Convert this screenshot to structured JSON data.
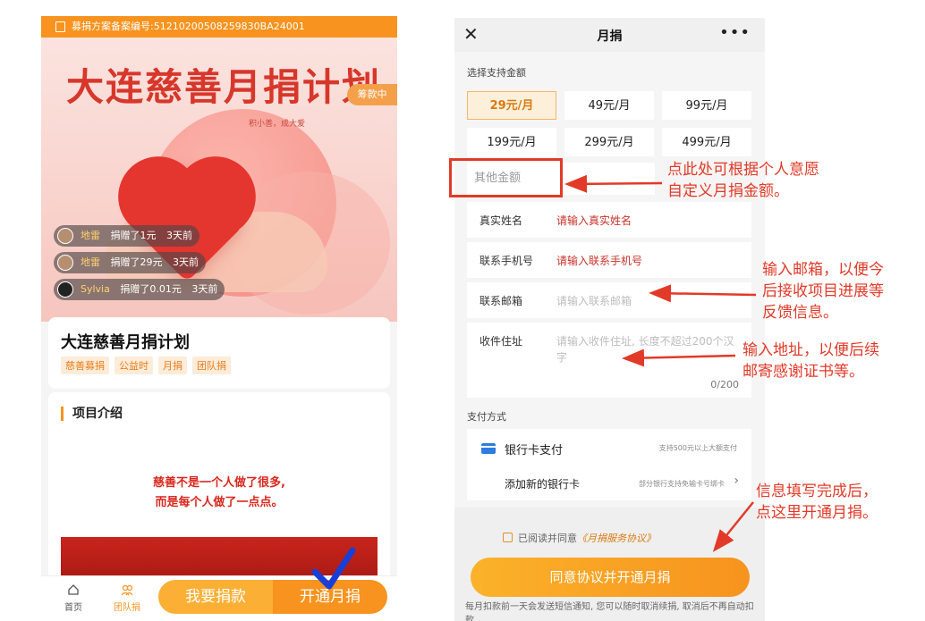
{
  "left": {
    "registration": "募捐方案备案编号:51210200508259830BA24001",
    "hero_title": "大连慈善月捐计划",
    "hero_subtitle": "积小善，成大爱",
    "status_tag": "筹款中",
    "donors": [
      {
        "name": "地雷",
        "action": "捐赠了1元",
        "time": "3天前"
      },
      {
        "name": "地雷",
        "action": "捐赠了29元",
        "time": "3天前"
      },
      {
        "name": "Sylvia",
        "action": "捐赠了0.01元",
        "time": "3天前"
      }
    ],
    "project_name": "大连慈善月捐计划",
    "tags": [
      "慈善募捐",
      "公益时",
      "月捐",
      "团队捐"
    ],
    "intro_heading": "项目介绍",
    "quote_line1": "慈善不是一个人做了很多,",
    "quote_line2": "而是每个人做了一点点。",
    "tabbar": {
      "home": "首页",
      "team": "团队捐",
      "donate": "我要捐款",
      "monthly": "开通月捐"
    }
  },
  "right": {
    "title": "月捐",
    "amount_label": "选择支持金额",
    "amounts": [
      "29元/月",
      "49元/月",
      "99元/月",
      "199元/月",
      "299元/月",
      "499元/月"
    ],
    "other_amount_placeholder": "其他金额",
    "fields": {
      "name_label": "真实姓名",
      "name_placeholder": "请输入真实姓名",
      "phone_label": "联系手机号",
      "phone_placeholder": "请输入联系手机号",
      "email_label": "联系邮箱",
      "email_placeholder": "请输入联系邮箱",
      "address_label": "收件住址",
      "address_placeholder": "请输入收件住址, 长度不超过200个汉字",
      "address_count": "0/200"
    },
    "payment_label": "支付方式",
    "payment": {
      "bank": "银行卡支付",
      "bank_note": "支持500元以上大额支付",
      "add_card": "添加新的银行卡",
      "add_card_note": "部分银行支持免输卡号绑卡"
    },
    "agree_text": "已阅读并同意",
    "agree_link": "《月捐服务协议》",
    "cta": "同意协议并开通月捐",
    "fine_print": "每月扣款前一天会发送短信通知, 您可以随时取消续捐, 取消后不再自动扣款"
  },
  "annotations": {
    "amount_1": "点此处可根据个人意愿",
    "amount_2": "自定义月捐金额。",
    "email_1": "输入邮箱，以便今",
    "email_2": "后接收项目进展等",
    "email_3": "反馈信息。",
    "address_1": "输入地址，以便后续",
    "address_2": "邮寄感谢证书等。",
    "submit_1": "信息填写完成后，",
    "submit_2": "点这里开通月捐。"
  },
  "colors": {
    "accent": "#f7931e",
    "annotation_red": "#e23a28",
    "check_blue": "#1a3fd6"
  }
}
